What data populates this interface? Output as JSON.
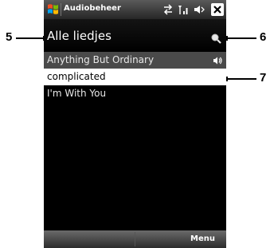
{
  "window": {
    "title": "Audiobeheer"
  },
  "header": {
    "title": "Alle liedjes"
  },
  "songs": [
    {
      "title": "Anything But Ordinary",
      "state": "playing"
    },
    {
      "title": "complicated",
      "state": "selected"
    },
    {
      "title": "I'm With You",
      "state": "normal"
    }
  ],
  "softkeys": {
    "left": "",
    "right": "Menu"
  },
  "callouts": {
    "five": "5",
    "six": "6",
    "seven": "7"
  },
  "icons": {
    "start": "windows-flag-icon",
    "connectivity": "sync-arrows-icon",
    "signal": "signal-icon",
    "volume": "speaker-icon",
    "close": "close-icon",
    "search": "search-icon",
    "now_playing": "speaker-icon"
  },
  "colors": {
    "selection_background": "#ffffff",
    "playing_background": "#4a4a4a",
    "screen_background": "#000000"
  }
}
